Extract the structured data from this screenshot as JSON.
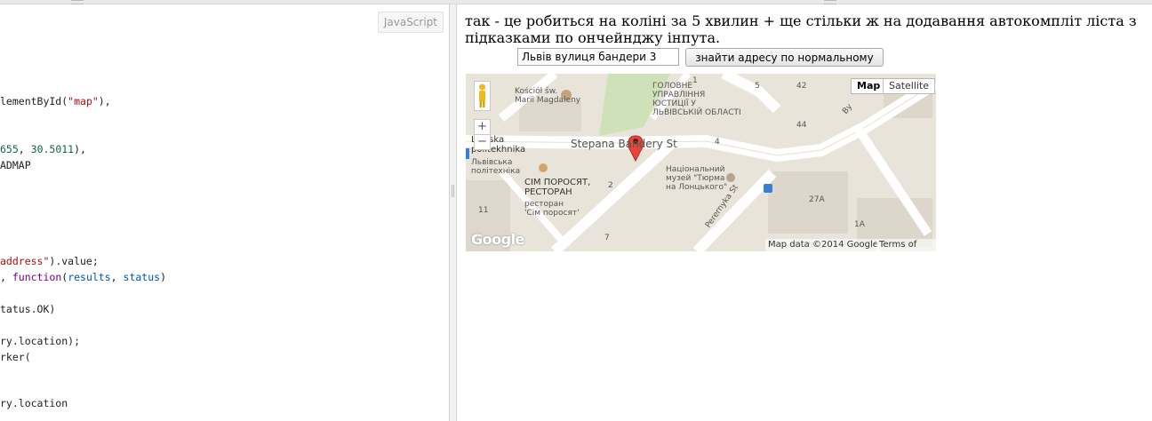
{
  "editor": {
    "language_label": "JavaScript",
    "lines": [
      {
        "top": 0,
        "parts": []
      },
      {
        "parts": [
          {
            "t": "lementById(",
            "c": ""
          },
          {
            "t": "\"map\"",
            "c": "str"
          },
          {
            "t": "),",
            "c": ""
          }
        ]
      },
      {
        "parts": [
          {
            "t": "655",
            "c": "num"
          },
          {
            "t": ", ",
            "c": ""
          },
          {
            "t": "30.5011",
            "c": "num"
          },
          {
            "t": "),",
            "c": ""
          }
        ]
      },
      {
        "parts": [
          {
            "t": "ADMAP",
            "c": ""
          }
        ]
      },
      {
        "parts": [
          {
            "t": "address\"",
            "c": "str"
          },
          {
            "t": ").value;",
            "c": ""
          }
        ]
      },
      {
        "parts": [
          {
            "t": ", ",
            "c": ""
          },
          {
            "t": "function",
            "c": "kw"
          },
          {
            "t": "(",
            "c": ""
          },
          {
            "t": "results",
            "c": "var"
          },
          {
            "t": ", ",
            "c": ""
          },
          {
            "t": "status",
            "c": "var"
          },
          {
            "t": ")",
            "c": ""
          }
        ]
      },
      {
        "parts": [
          {
            "t": "tatus.OK)",
            "c": ""
          }
        ]
      },
      {
        "parts": [
          {
            "t": "ry.location);",
            "c": ""
          }
        ]
      },
      {
        "parts": [
          {
            "t": "rker(",
            "c": ""
          }
        ]
      },
      {
        "parts": [
          {
            "t": "ry.location",
            "c": ""
          }
        ]
      }
    ]
  },
  "result": {
    "heading": "так - це робиться на коліні за 5 хвилин + ще стільки ж на додавання автокомпліт ліста з підказками по ончейнджу інпута.",
    "address_value": "Львів вулиця бандери 3",
    "find_button_label": "знайти адресу по нормальному"
  },
  "map": {
    "map_type_map": "Map",
    "map_type_satellite": "Satellite",
    "zoom_in": "+",
    "zoom_out": "−",
    "logo": "Google",
    "map_data": "Map data ©2014 Google",
    "terms": "Terms of Use",
    "labels": {
      "church": "Kościół św.\nMarii Magdaleny",
      "ministry": "ГОЛОВНЕ\nУПРАВЛІННЯ\nЮСТИЦІЇ У\nЛЬВІВСЬКІЙ ОБЛАСТІ",
      "street_bandery": "Stepana Bandery St",
      "politekhnika": "Lvivska\npolitekhnika",
      "politekhnika_uk": "Львівська\nполітехніка",
      "restaurant": "СІМ ПОРОСЯТ,\nРЕСТОРАН",
      "restaurant_sub": "ресторан\n'Сім поросят'",
      "museum": "Національний\nмузей \"Тюрма\nна Лонцького\"",
      "street_pereyma": "Perernyka St",
      "street_right": "Ву",
      "house_5": "5",
      "house_42": "42",
      "house_44": "44",
      "house_1": "1",
      "house_4": "4",
      "house_2": "2",
      "house_11": "11",
      "house_7": "7",
      "house_27a": "27A",
      "house_1a": "1A"
    }
  }
}
